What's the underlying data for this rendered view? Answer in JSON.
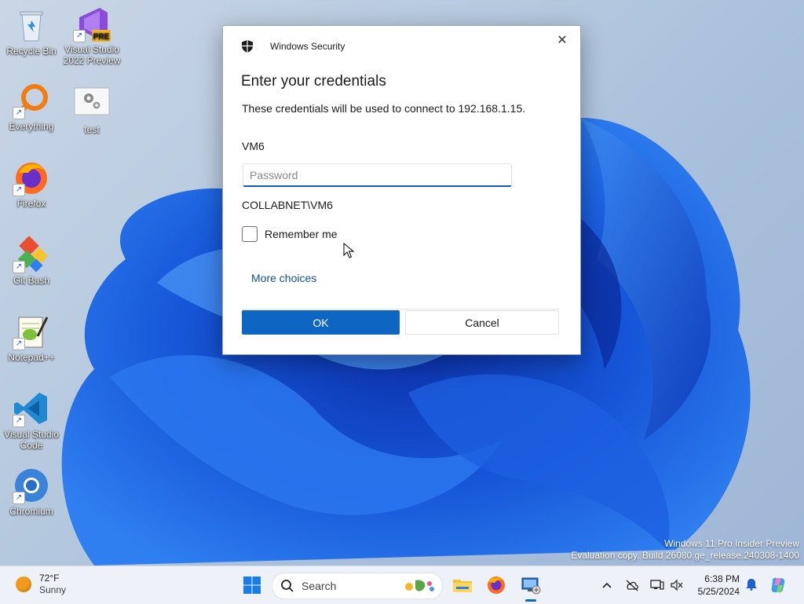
{
  "desktop": {
    "icons": [
      {
        "name": "recycle-bin",
        "label": "Recycle Bin"
      },
      {
        "name": "visual-studio-2022-preview",
        "label": "Visual Studio 2022 Preview",
        "badge": "PRE"
      },
      {
        "name": "everything",
        "label": "Everything"
      },
      {
        "name": "test",
        "label": "test"
      },
      {
        "name": "firefox",
        "label": "Firefox"
      },
      {
        "name": "git-bash",
        "label": "Git Bash"
      },
      {
        "name": "notepad-plus-plus",
        "label": "Notepad++"
      },
      {
        "name": "visual-studio-code",
        "label": "Visual Studio Code"
      },
      {
        "name": "chromium",
        "label": "Chromium"
      }
    ],
    "watermark": {
      "line1": "Windows 11 Pro Insider Preview",
      "line2": "Evaluation copy. Build 26080.ge_release.240308-1400"
    }
  },
  "dialog": {
    "app_name": "Windows Security",
    "title": "Enter your credentials",
    "description": "These credentials will be used to connect to 192.168.1.15.",
    "username": "VM6",
    "password": {
      "value": "",
      "placeholder": "Password"
    },
    "domain_user": "COLLABNET\\VM6",
    "remember_label": "Remember me",
    "remember_checked": false,
    "more_choices": "More choices",
    "ok_label": "OK",
    "cancel_label": "Cancel",
    "close_glyph": "✕"
  },
  "taskbar": {
    "weather": {
      "temp": "72°F",
      "condition": "Sunny"
    },
    "search_label": "Search",
    "apps": [
      "start-icon",
      "file-explorer-icon",
      "firefox-icon",
      "remote-desktop-icon"
    ],
    "clock": {
      "time": "6:38 PM",
      "date": "5/25/2024"
    }
  },
  "colors": {
    "accent": "#0f66c2",
    "link": "#0f4f99",
    "taskbar_bg": "#eef2f8"
  }
}
